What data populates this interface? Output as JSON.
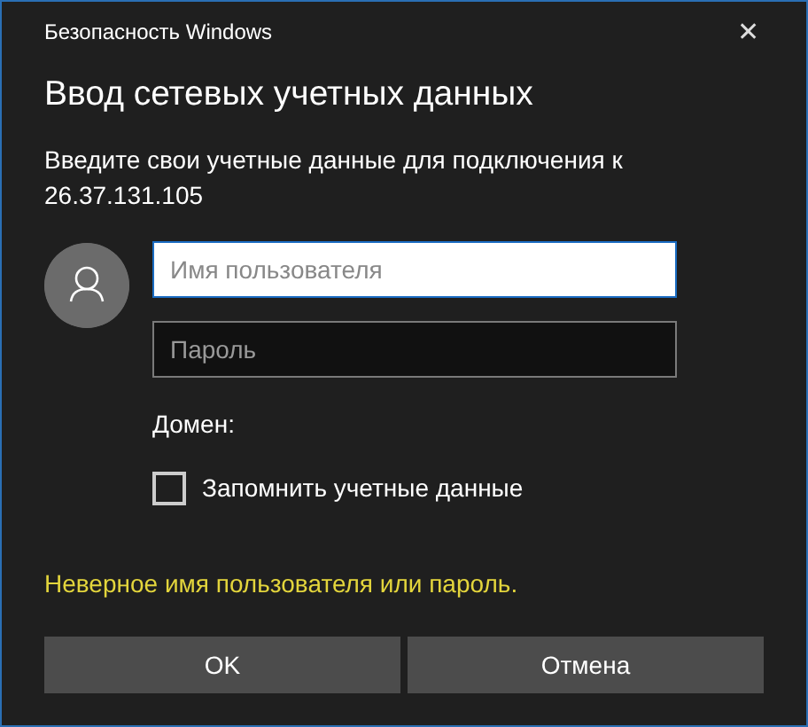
{
  "window": {
    "title": "Безопасность Windows",
    "close": "✕"
  },
  "heading": "Ввод сетевых учетных данных",
  "description": "Введите свои учетные данные для подключения к 26.37.131.105",
  "fields": [
    {
      "placeholder": "Имя пользователя",
      "focused": true
    },
    {
      "placeholder": "Пароль",
      "focused": false
    }
  ],
  "domain_label": "Домен:",
  "remember": {
    "label": "Запомнить учетные данные",
    "checked": false
  },
  "error": "Неверное имя пользователя или пароль.",
  "buttons": [
    "OK",
    "Отмена"
  ]
}
